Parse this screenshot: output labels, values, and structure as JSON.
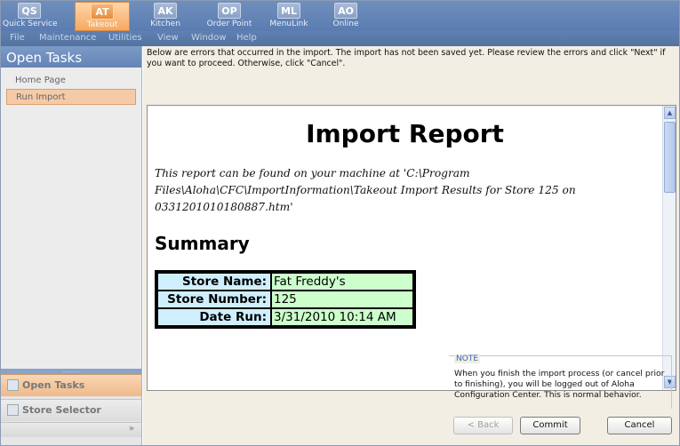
{
  "apps": [
    {
      "abbr": "QS",
      "label": "Quick Service"
    },
    {
      "abbr": "AT",
      "label": "Takeout"
    },
    {
      "abbr": "AK",
      "label": "Kitchen"
    },
    {
      "abbr": "OP",
      "label": "Order Point"
    },
    {
      "abbr": "ML",
      "label": "MenuLink"
    },
    {
      "abbr": "AO",
      "label": "Online"
    }
  ],
  "active_app": "Takeout",
  "menu": {
    "file": "File",
    "maintenance": "Maintenance",
    "utilities": "Utilities",
    "view": "View",
    "window": "Window",
    "help": "Help"
  },
  "sidebar": {
    "title": "Open Tasks",
    "items": [
      {
        "label": "Home Page"
      },
      {
        "label": "Run Import"
      }
    ],
    "selected": "Run Import",
    "grip": "..........",
    "panes": {
      "open_tasks": "Open Tasks",
      "store_selector": "Store Selector",
      "more": "»"
    }
  },
  "main": {
    "message": "Below are errors that occurred in the import.  The import has not been saved yet.  Please review the errors and click \"Next\" if you want to proceed.  Otherwise, click \"Cancel\"."
  },
  "report": {
    "title": "Import Report",
    "path_note": "This report can be found on your machine at 'C:\\Program Files\\Aloha\\CFC\\ImportInformation\\Takeout Import Results for Store 125 on 0331201010180887.htm'",
    "summary_heading": "Summary",
    "summary": {
      "store_name_label": "Store Name:",
      "store_name": "Fat Freddy's",
      "store_number_label": "Store Number:",
      "store_number": "125",
      "date_run_label": "Date Run:",
      "date_run": "3/31/2010 10:14 AM"
    }
  },
  "note": {
    "label": "NOTE",
    "text": "When you finish the import process (or cancel prior to finishing), you will be logged out of Aloha Configuration Center. This is normal behavior."
  },
  "buttons": {
    "back": "< Back",
    "commit": "Commit",
    "cancel": "Cancel"
  },
  "colors": {
    "accent": "#f5a963",
    "header_blue": "#5a7cb0",
    "label_cell": "#cfefff",
    "value_cell": "#ccffcc",
    "note_label": "#3567b4"
  },
  "icons": {
    "open_tasks_pane": "tasks-icon",
    "store_selector_pane": "store-icon",
    "scroll_up": "arrow-up-icon",
    "scroll_down": "arrow-down-icon"
  }
}
